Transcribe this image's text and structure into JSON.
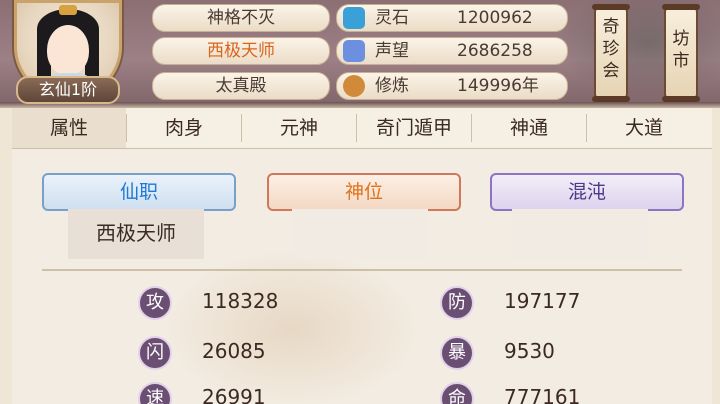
{
  "header": {
    "rank_label": "玄仙1阶",
    "titles": [
      "神格不灭",
      "西极天师",
      "太真殿"
    ],
    "resources": [
      {
        "label": "灵石",
        "value": "1200962",
        "icon": "spirit-stone-icon",
        "color": "#3aa0d8"
      },
      {
        "label": "声望",
        "value": "2686258",
        "icon": "reputation-icon",
        "color": "#6c8fe0"
      },
      {
        "label": "修炼",
        "value": "149996年",
        "icon": "meditation-icon",
        "color": "#d18a3a"
      }
    ],
    "buttons": [
      "奇珍会",
      "坊市"
    ]
  },
  "tabs": [
    "属性",
    "肉身",
    "元神",
    "奇门遁甲",
    "神通",
    "大道"
  ],
  "panels": {
    "xianzhi": {
      "title": "仙职",
      "value": "西极天师"
    },
    "shenwei": {
      "title": "神位",
      "value": ""
    },
    "hundun": {
      "title": "混沌",
      "value": ""
    }
  },
  "stats": [
    {
      "label": "攻",
      "value": "118328"
    },
    {
      "label": "防",
      "value": "197177"
    },
    {
      "label": "闪",
      "value": "26085"
    },
    {
      "label": "暴",
      "value": "9530"
    },
    {
      "label": "速",
      "value": "26991"
    },
    {
      "label": "命",
      "value": "777161"
    }
  ]
}
